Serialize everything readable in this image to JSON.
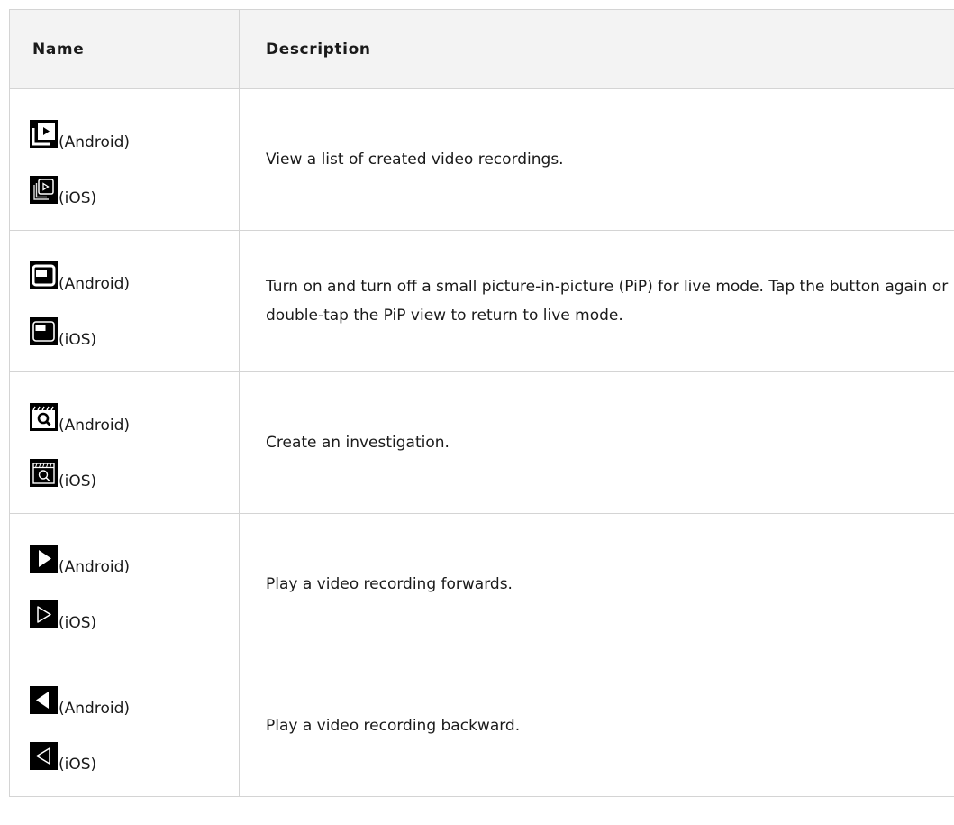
{
  "table": {
    "headers": {
      "name": "Name",
      "description": "Description"
    },
    "rows": [
      {
        "android_icon": "recordings-list-icon",
        "ios_icon": "recordings-list-icon",
        "android_label": "(Android)",
        "ios_label": "(iOS)",
        "description": "View a list of created video recordings."
      },
      {
        "android_icon": "picture-in-picture-icon",
        "ios_icon": "picture-in-picture-icon",
        "android_label": "(Android)",
        "ios_label": "(iOS)",
        "description": "Turn on and turn off a small picture-in-picture (PiP) for live mode. Tap the button again or double-tap the PiP view to return to live mode."
      },
      {
        "android_icon": "investigation-icon",
        "ios_icon": "investigation-icon",
        "android_label": "(Android)",
        "ios_label": "(iOS)",
        "description": "Create an investigation."
      },
      {
        "android_icon": "play-forward-icon",
        "ios_icon": "play-forward-icon",
        "android_label": "(Android)",
        "ios_label": "(iOS)",
        "description": "Play a video recording forwards."
      },
      {
        "android_icon": "play-backward-icon",
        "ios_icon": "play-backward-icon",
        "android_label": "(Android)",
        "ios_label": "(iOS)",
        "description": "Play a video recording backward."
      }
    ]
  }
}
